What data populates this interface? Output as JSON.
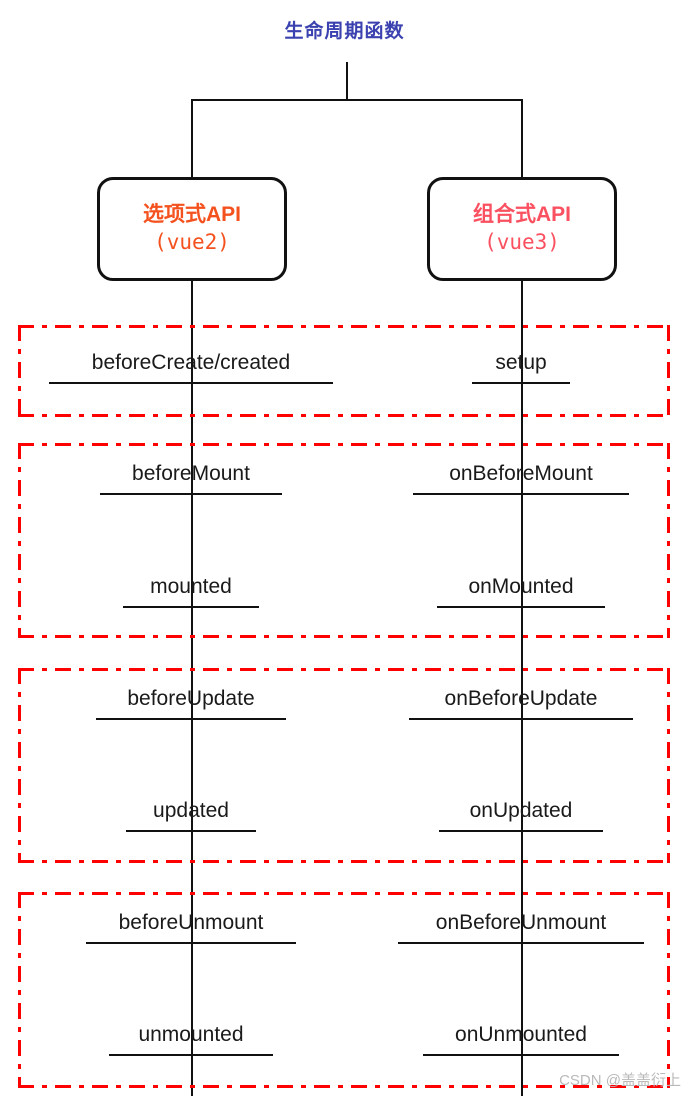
{
  "title": "生命周期函数",
  "colors": {
    "title": "#3b42b0",
    "options_api": "#f4511e",
    "composition_api": "#fa5060",
    "group_border": "#ff0000",
    "line": "#111111",
    "text": "#1a1a1a",
    "watermark": "#b9b9b9"
  },
  "boxes": {
    "left": {
      "line1": "选项式API",
      "line2": "(vue2)"
    },
    "right": {
      "line1": "组合式API",
      "line2": "(vue3)"
    }
  },
  "groups": [
    {
      "name": "create-stage",
      "rows": [
        {
          "left": "beforeCreate/created",
          "right": "setup"
        }
      ]
    },
    {
      "name": "mount-stage",
      "rows": [
        {
          "left": "beforeMount",
          "right": "onBeforeMount"
        },
        {
          "left": "mounted",
          "right": "onMounted"
        }
      ]
    },
    {
      "name": "update-stage",
      "rows": [
        {
          "left": "beforeUpdate",
          "right": "onBeforeUpdate"
        },
        {
          "left": "updated",
          "right": "onUpdated"
        }
      ]
    },
    {
      "name": "unmount-stage",
      "rows": [
        {
          "left": "beforeUnmount",
          "right": "onBeforeUnmount"
        },
        {
          "left": "unmounted",
          "right": "onUnmounted"
        }
      ]
    }
  ],
  "watermark": "CSDN @盖盖衍上"
}
